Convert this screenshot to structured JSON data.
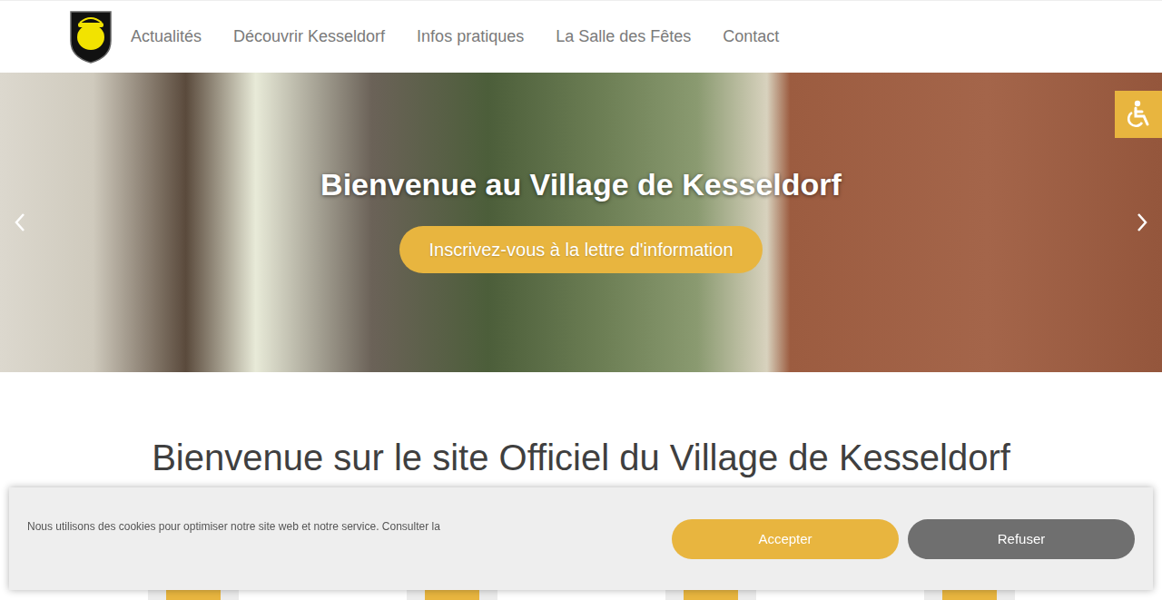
{
  "header": {
    "nav": [
      {
        "label": "Actualités"
      },
      {
        "label": "Découvrir Kesseldorf"
      },
      {
        "label": "Infos pratiques"
      },
      {
        "label": "La Salle des Fêtes"
      },
      {
        "label": "Contact"
      }
    ]
  },
  "hero": {
    "title": "Bienvenue au Village de Kesseldorf",
    "button": "Inscrivez-vous à la lettre d'information"
  },
  "heading": "Bienvenue sur le site Officiel du Village de Kesseldorf",
  "cookie_banner": {
    "text": "Nous utilisons des cookies pour optimiser notre site web et notre service. Consulter la",
    "buttons": [
      {
        "label": "Accepter",
        "color": "#e8b53f"
      },
      {
        "label": "Refuser",
        "color": "#6f6f6f"
      }
    ]
  }
}
